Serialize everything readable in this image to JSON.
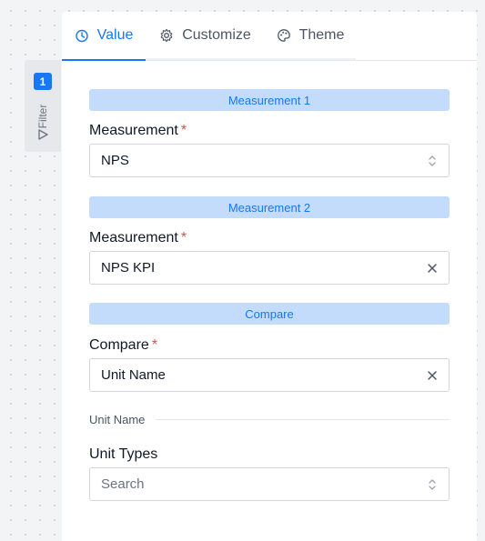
{
  "filter": {
    "badge": "1",
    "label": "Filter"
  },
  "tabs": [
    {
      "label": "Value",
      "icon": "timer-icon",
      "active": true
    },
    {
      "label": "Customize",
      "icon": "gear-icon",
      "active": false
    },
    {
      "label": "Theme",
      "icon": "palette-icon",
      "active": false
    }
  ],
  "sections": {
    "measurement1": "Measurement 1",
    "measurement2": "Measurement 2",
    "compare": "Compare"
  },
  "fields": {
    "measurement1": {
      "label": "Measurement",
      "required": "*",
      "value": "NPS",
      "icon": "chevron-updown-icon"
    },
    "measurement2": {
      "label": "Measurement",
      "required": "*",
      "value": "NPS KPI",
      "icon": "close-icon"
    },
    "compare": {
      "label": "Compare",
      "required": "*",
      "value": "Unit Name",
      "icon": "close-icon"
    },
    "unit_types": {
      "label": "Unit Types",
      "placeholder": "Search",
      "icon": "chevron-updown-icon"
    }
  },
  "divider": {
    "label": "Unit Name"
  },
  "colors": {
    "accent": "#1877f2",
    "section_bg": "#c4dcfb",
    "required": "#ef4444"
  }
}
